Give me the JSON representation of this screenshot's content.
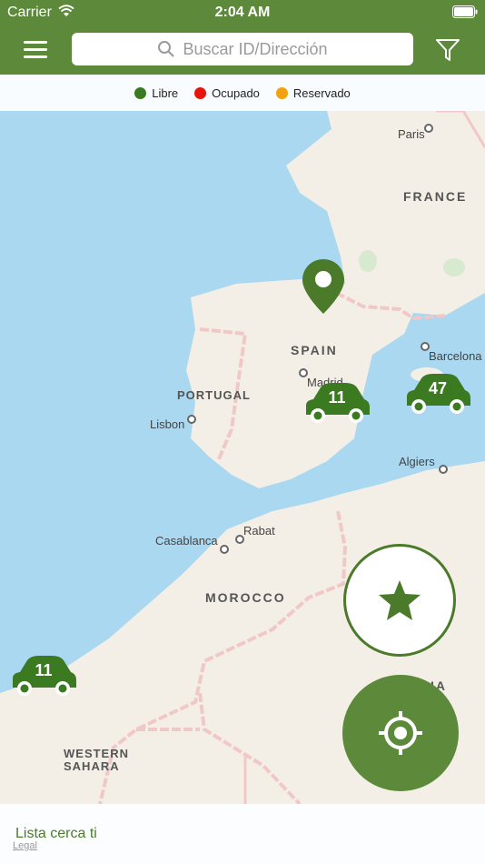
{
  "status_bar": {
    "carrier": "Carrier",
    "time": "2:04 AM"
  },
  "header": {
    "search_placeholder": "Buscar ID/Dirección",
    "menu_icon": "hamburger-menu-icon",
    "filter_icon": "filter-icon"
  },
  "legend": {
    "items": [
      {
        "label": "Libre",
        "color": "#3c7a22"
      },
      {
        "label": "Ocupado",
        "color": "#e8140c"
      },
      {
        "label": "Reservado",
        "color": "#f2a20d"
      }
    ]
  },
  "map": {
    "countries": {
      "france": "FRANCE",
      "spain": "SPAIN",
      "portugal": "PORTUGAL",
      "morocco": "MOROCCO",
      "western_sahara": "WESTERN\nSAHARA",
      "algeria_partial": "IA"
    },
    "cities": {
      "paris": "Paris",
      "madrid": "Madrid",
      "lisbon": "Lisbon",
      "barcelona": "Barcelona",
      "algiers": "Algiers",
      "rabat": "Rabat",
      "casablanca": "Casablanca"
    },
    "clusters": {
      "madrid_cluster": "11",
      "baleares_cluster": "47",
      "canarias_cluster": "11"
    },
    "brand_color": "#4a7a2a"
  },
  "bottom_panel": {
    "title": "Lista cerca ti",
    "legal": "Legal"
  }
}
